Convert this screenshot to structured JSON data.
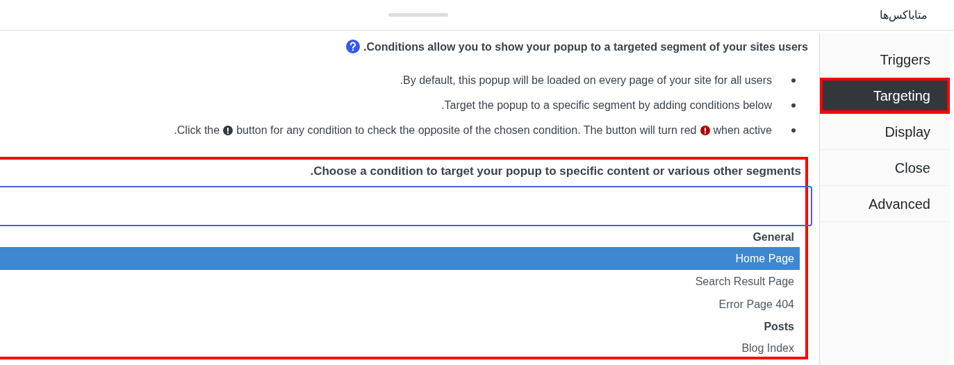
{
  "header": {
    "title": "متاباکس‌ها"
  },
  "tabs": [
    {
      "label": "Triggers",
      "selected": false,
      "highlighted": false
    },
    {
      "label": "Targeting",
      "selected": true,
      "highlighted": true
    },
    {
      "label": "Display",
      "selected": false,
      "highlighted": false
    },
    {
      "label": "Close",
      "selected": false,
      "highlighted": false
    },
    {
      "label": "Advanced",
      "selected": false,
      "highlighted": false
    }
  ],
  "intro": "Conditions allow you to show your popup to a targeted segment of your sites users.",
  "bullets": [
    [
      {
        "kind": "text",
        "text": "By default, this popup will be loaded on every page of your site for all users."
      }
    ],
    [
      {
        "kind": "text",
        "text": "Target the popup to a specific segment by adding conditions below."
      }
    ],
    [
      {
        "kind": "text",
        "text": ".Click the"
      },
      {
        "kind": "icon",
        "color": "#343a40"
      },
      {
        "kind": "text",
        "text": "button for any condition to check the opposite of the chosen condition. The button will turn red"
      },
      {
        "kind": "icon",
        "color": "#b30000"
      },
      {
        "kind": "text",
        "text": "when active"
      }
    ]
  ],
  "condition": {
    "label": "Choose a condition to target your popup to specific content or various other segments.",
    "highlighted": true,
    "options": [
      {
        "kind": "group",
        "label": "General"
      },
      {
        "kind": "option",
        "label": "Home Page",
        "selected": true
      },
      {
        "kind": "option",
        "label": "Search Result Page",
        "selected": false
      },
      {
        "kind": "option",
        "label": "Error Page 404",
        "selected": false
      },
      {
        "kind": "group",
        "label": "Posts"
      },
      {
        "kind": "option",
        "label": "Blog Index",
        "selected": false
      }
    ]
  }
}
